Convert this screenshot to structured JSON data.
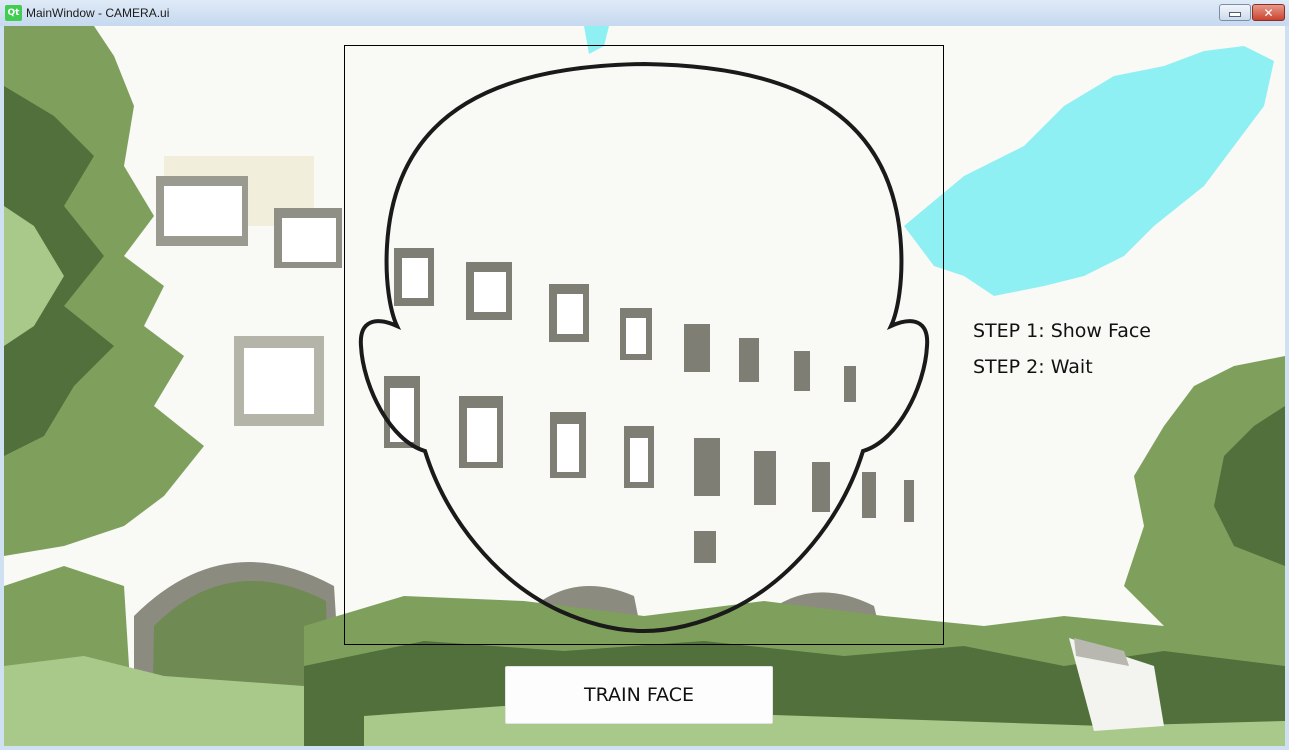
{
  "window": {
    "title": "MainWindow - CAMERA.ui",
    "logo_text": "Qt"
  },
  "steps": {
    "step1": "STEP 1: Show Face",
    "step2": "STEP 2: Wait"
  },
  "actions": {
    "train_face": "TRAIN FACE"
  },
  "colors": {
    "sky_cyan": "#8ff0f4",
    "foliage_green": "#7fa05d",
    "dark_green": "#52703b",
    "light_green": "#a9c98a",
    "building_gray": "#8b8b80",
    "cream": "#f2f0da"
  }
}
